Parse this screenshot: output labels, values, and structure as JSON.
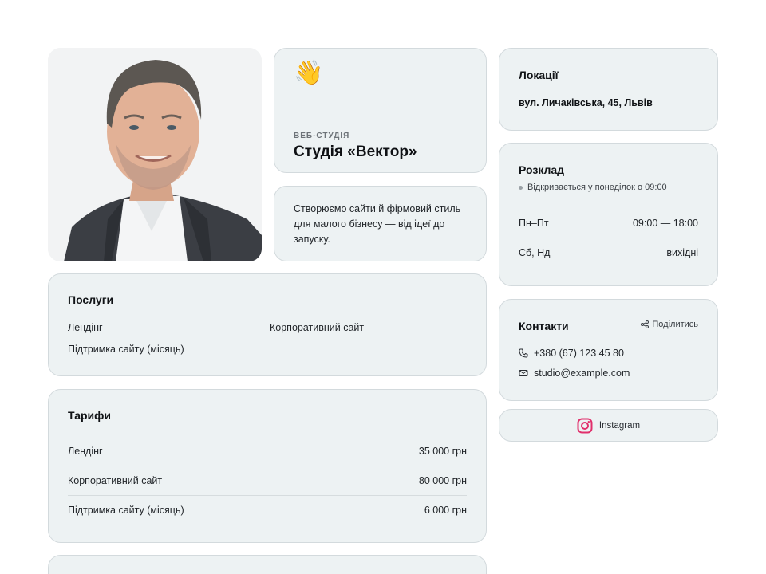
{
  "hero": {
    "eyebrow": "ВЕБ-СТУДІЯ",
    "title": "Студія «Вектор»",
    "wave_emoji": "👋"
  },
  "description": "Створюємо сайти й фірмовий стиль для малого бізнесу — від ідеї до запуску.",
  "services": {
    "title": "Послуги",
    "items": [
      "Лендінг",
      "Корпоративний сайт",
      "Підтримка сайту (місяць)"
    ]
  },
  "pricing": {
    "title": "Тарифи",
    "items": [
      {
        "name": "Лендінг",
        "price": "35 000 грн"
      },
      {
        "name": "Корпоративний сайт",
        "price": "80 000 грн"
      },
      {
        "name": "Підтримка сайту (місяць)",
        "price": "6 000 грн"
      }
    ]
  },
  "locations": {
    "title": "Локації",
    "address": "вул. Личаківська, 45, Львів"
  },
  "schedule": {
    "title": "Розклад",
    "status": "Відкривається у понеділок о 09:00",
    "rows": [
      {
        "days": "Пн–Пт",
        "hours": "09:00 — 18:00"
      },
      {
        "days": "Сб, Нд",
        "hours": "вихідні"
      }
    ]
  },
  "contacts": {
    "title": "Контакти",
    "share_label": "Поділитись",
    "phone": "+380 (67) 123 45 80",
    "email": "studio@example.com"
  },
  "social": {
    "instagram_label": "Instagram"
  },
  "colors": {
    "card_bg": "#edf2f3",
    "card_border": "#d3dadd",
    "instagram_accent": "#e1306c"
  }
}
